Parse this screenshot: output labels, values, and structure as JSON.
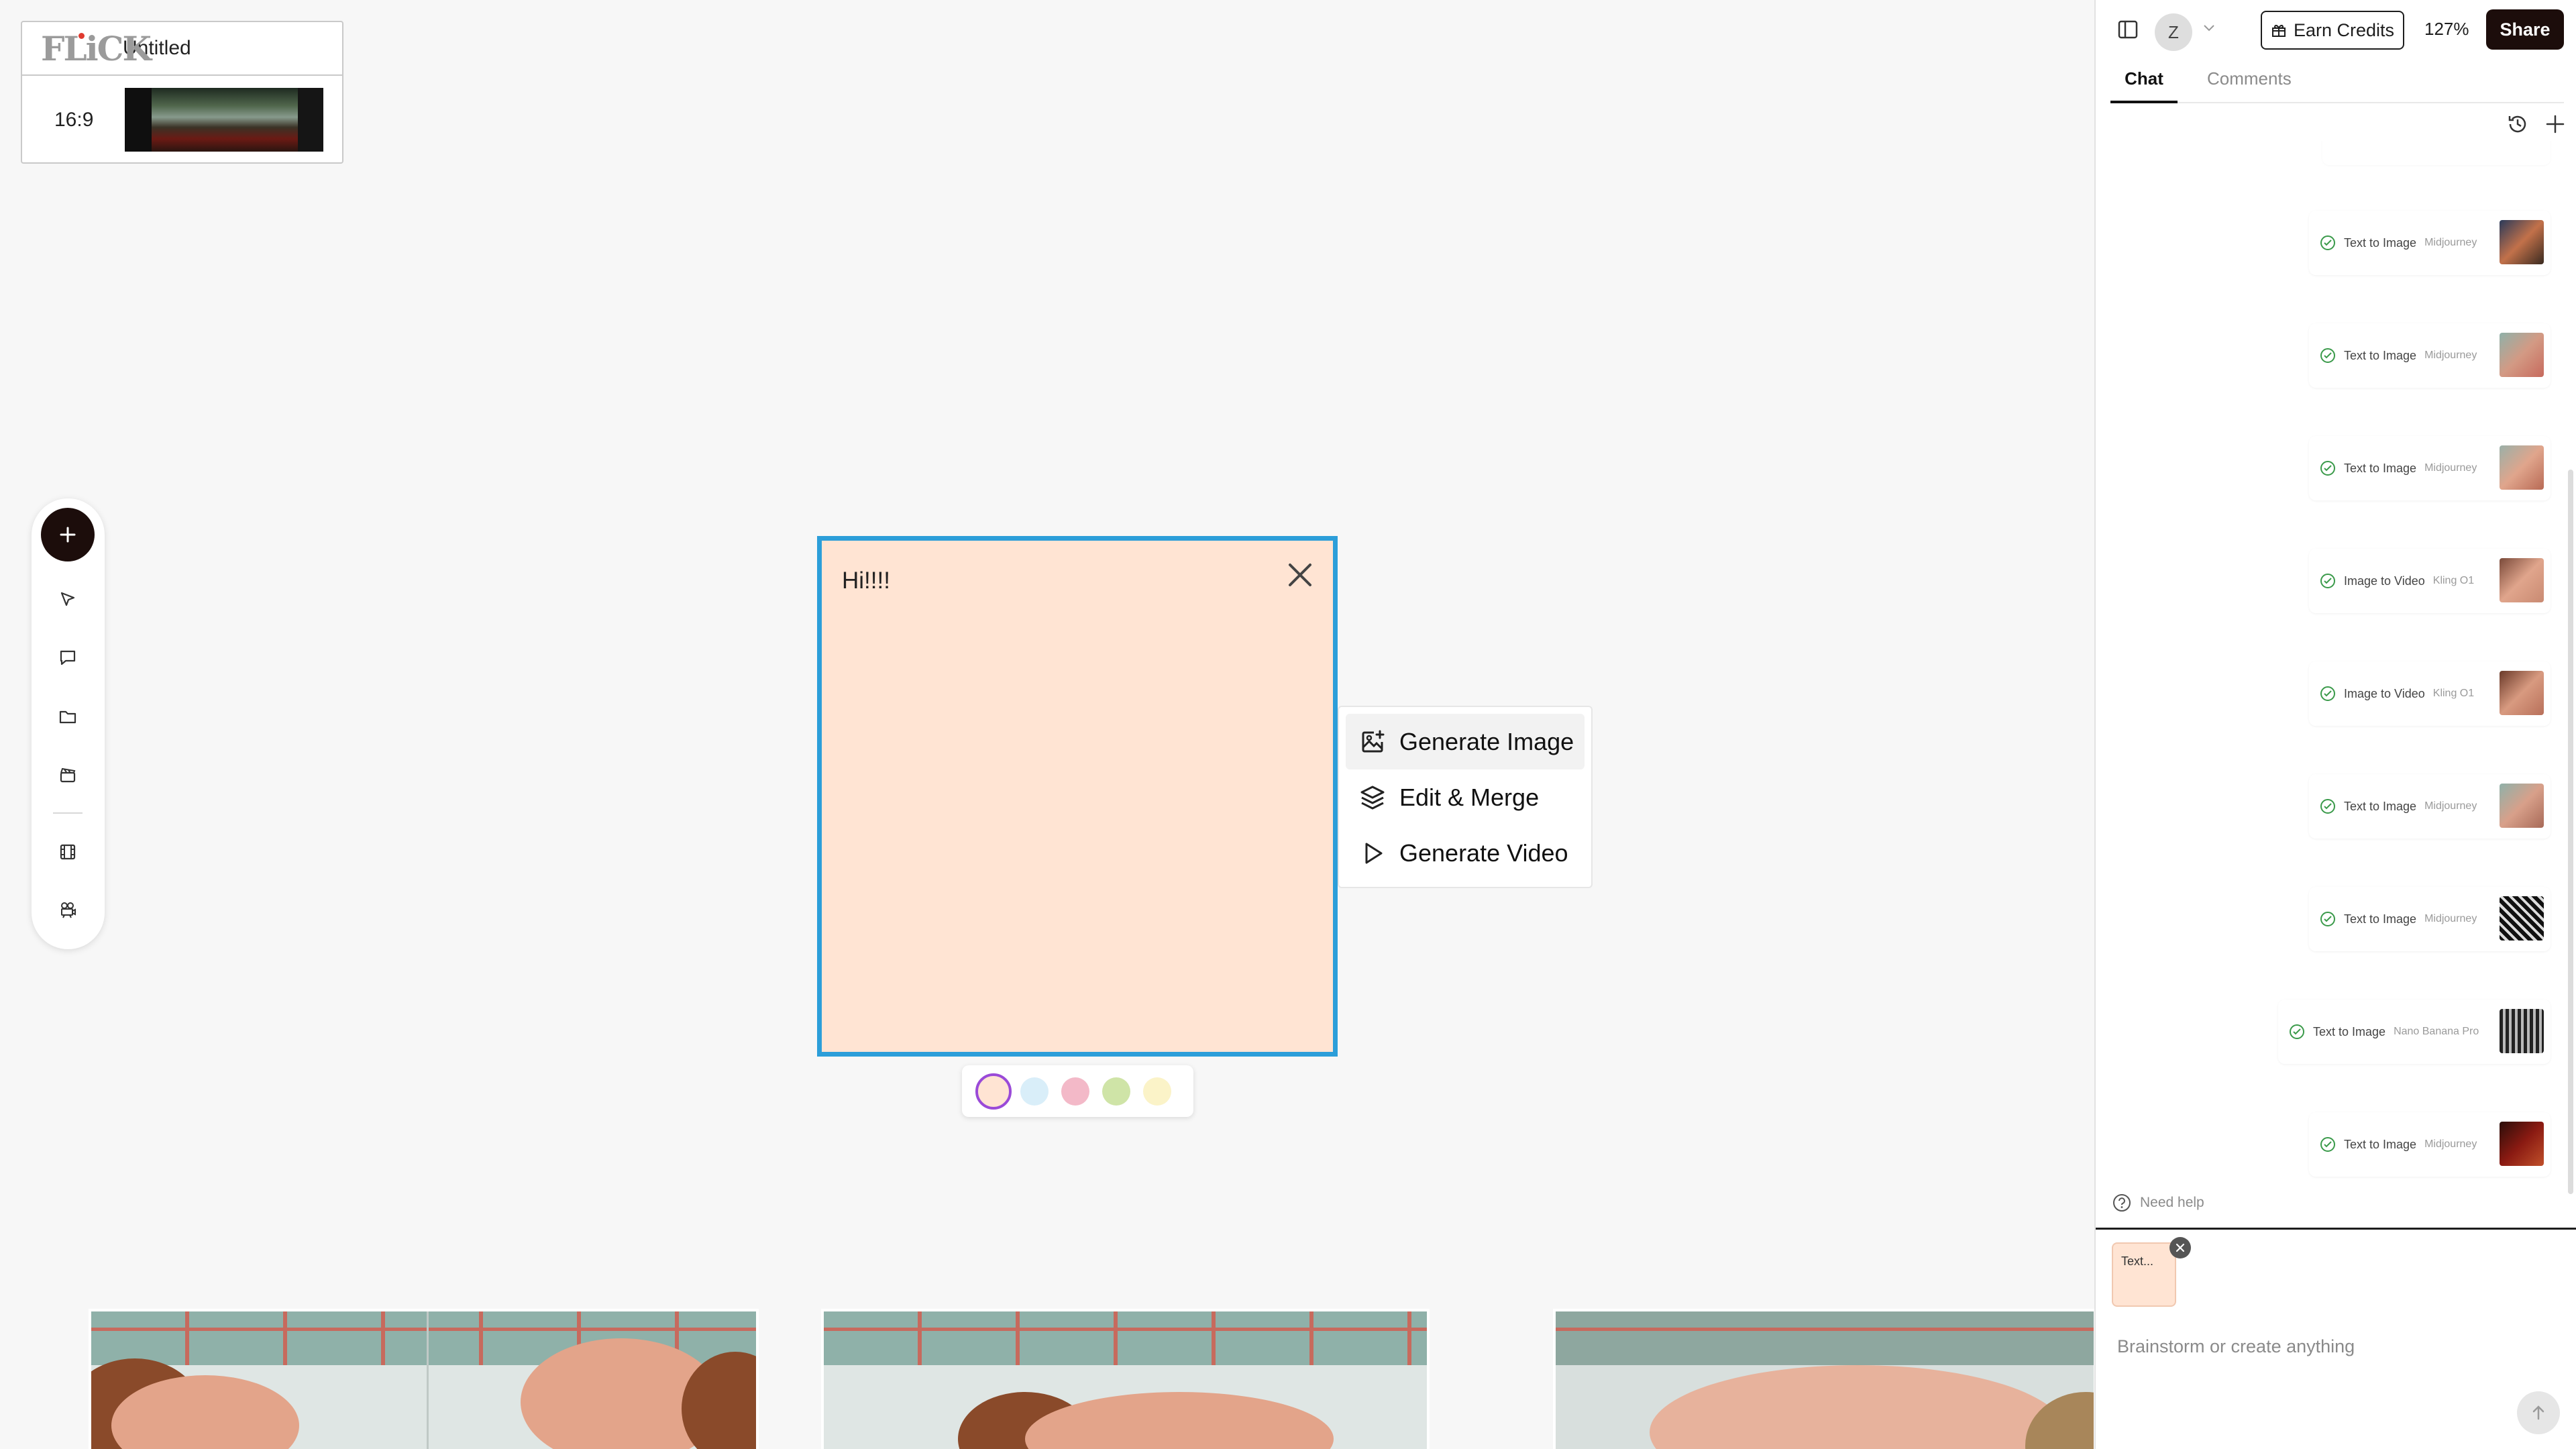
{
  "project": {
    "logo": "FLiCK",
    "name": "Untitled",
    "ratio": "16:9"
  },
  "note": {
    "text": "Hi!!!!"
  },
  "context_menu": {
    "items": [
      {
        "label": "Generate Image",
        "icon": "image-sparkle-icon"
      },
      {
        "label": "Edit & Merge",
        "icon": "layers-icon"
      },
      {
        "label": "Generate Video",
        "icon": "play-icon"
      }
    ]
  },
  "swatches": {
    "colors": [
      "#ffe4d3",
      "#d9eef9",
      "#f3b9c8",
      "#cfe4a7",
      "#fbf3c8"
    ],
    "selected": 0
  },
  "colors": {
    "accent": "#1c0d0b",
    "selection": "#2c9ed9",
    "success": "#3a9a4a"
  },
  "header": {
    "avatar": "Z",
    "earn_credits": "Earn Credits",
    "zoom": "127%",
    "share": "Share"
  },
  "tabs": [
    "Chat",
    "Comments"
  ],
  "messages": [
    {
      "type": "Text to Image",
      "model": "Midjourney"
    },
    {
      "type": "Text to Image",
      "model": "Midjourney"
    },
    {
      "type": "Text to Image",
      "model": "Midjourney"
    },
    {
      "type": "Image to Video",
      "model": "Kling O1"
    },
    {
      "type": "Image to Video",
      "model": "Kling O1"
    },
    {
      "type": "Text to Image",
      "model": "Midjourney"
    },
    {
      "type": "Text to Image",
      "model": "Midjourney"
    },
    {
      "type": "Text to Image",
      "model": "Nano Banana Pro"
    },
    {
      "type": "Text to Image",
      "model": "Midjourney"
    }
  ],
  "help": "Need help",
  "composer": {
    "attachment": "Text...",
    "placeholder": "Brainstorm or create anything"
  }
}
